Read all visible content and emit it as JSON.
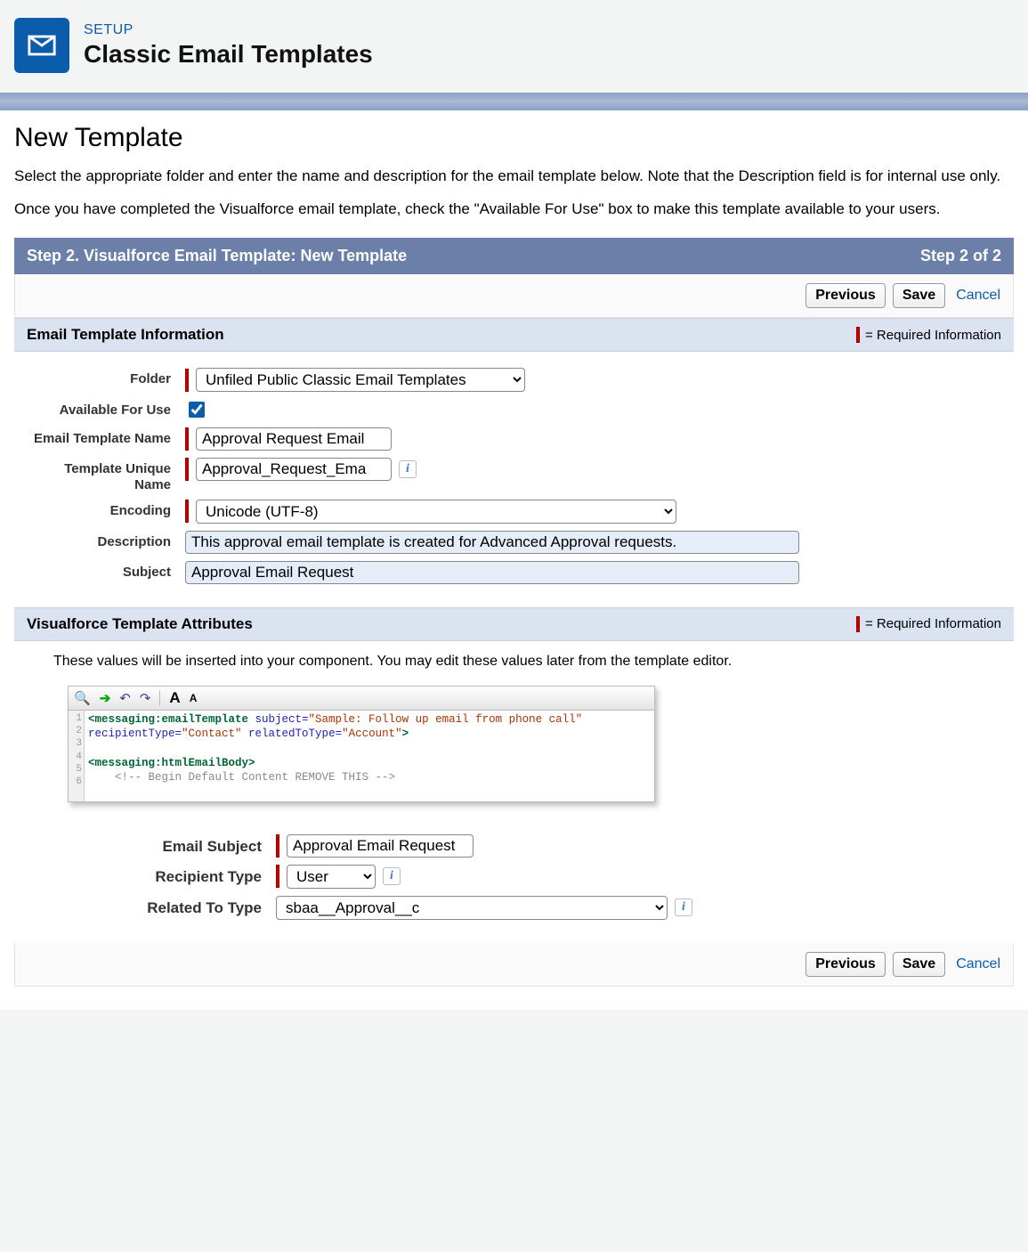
{
  "header": {
    "kicker": "SETUP",
    "title": "Classic Email Templates"
  },
  "page": {
    "heading": "New Template",
    "para1": "Select the appropriate folder and enter the name and description for the email template below. Note that the Description field is for internal use only.",
    "para2": "Once you have completed the Visualforce email template, check the \"Available For Use\" box to make this template available to your users."
  },
  "step": {
    "title": "Step 2. Visualforce Email Template: New Template",
    "indicator": "Step 2 of 2"
  },
  "toolbar": {
    "previous": "Previous",
    "save": "Save",
    "cancel": "Cancel"
  },
  "section1": {
    "title": "Email Template Information",
    "required_hint": "= Required Information",
    "labels": {
      "folder": "Folder",
      "available": "Available For Use",
      "name": "Email Template Name",
      "unique": "Template Unique Name",
      "encoding": "Encoding",
      "description": "Description",
      "subject": "Subject"
    },
    "values": {
      "folder": "Unfiled Public Classic Email Templates",
      "available_checked": true,
      "name": "Approval Request Email",
      "unique": "Approval_Request_Ema",
      "encoding": "Unicode (UTF-8)",
      "description": "This approval email template is created for Advanced Approval requests.",
      "subject": "Approval Email Request"
    }
  },
  "section2": {
    "title": "Visualforce Template Attributes",
    "required_hint": "= Required Information",
    "intro": "These values will be inserted into your component. You may edit these values later from the template editor.",
    "labels": {
      "email_subject": "Email Subject",
      "recipient": "Recipient Type",
      "related": "Related To Type"
    },
    "values": {
      "email_subject": "Approval Email Request",
      "recipient": "User",
      "related": "sbaa__Approval__c"
    },
    "code": {
      "line1a": "<messaging:emailTemplate ",
      "line1b": "subject=",
      "line1c": "\"Sample: Follow up email from phone call\"",
      "line2a": "recipientType=",
      "line2b": "\"Contact\"",
      "line2c": " relatedToType=",
      "line2d": "\"Account\"",
      "line2e": ">",
      "line4": "<messaging:htmlEmailBody>",
      "line5": "    <!-- Begin Default Content REMOVE THIS -->"
    }
  }
}
